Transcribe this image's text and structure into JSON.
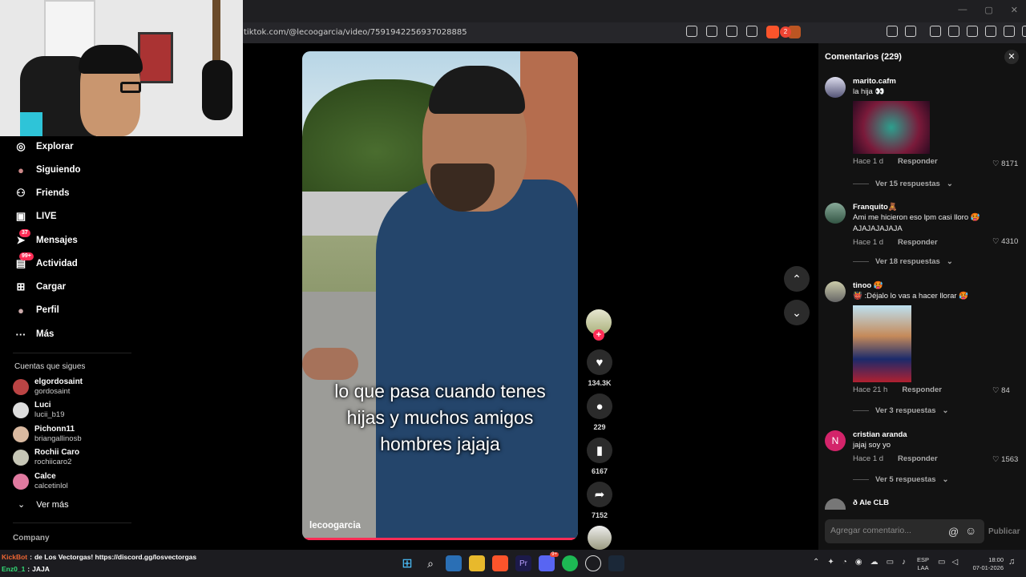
{
  "browser": {
    "url": "tiktok.com/@lecoogarcia/video/7591942256937028885",
    "brave_badge": "2",
    "window_controls": [
      "—",
      "▢",
      "✕"
    ]
  },
  "sidebar": {
    "items": [
      {
        "label": "Explorar",
        "icon": "compass-icon",
        "glyph": "◎"
      },
      {
        "label": "Siguiendo",
        "icon": "following-avatar-icon",
        "glyph": "●"
      },
      {
        "label": "Friends",
        "icon": "friends-icon",
        "glyph": "⚇"
      },
      {
        "label": "LIVE",
        "icon": "live-icon",
        "glyph": "▣"
      },
      {
        "label": "Mensajes",
        "icon": "messages-icon",
        "glyph": "➤",
        "badge": "37"
      },
      {
        "label": "Actividad",
        "icon": "activity-icon",
        "glyph": "▤",
        "badge": "99+"
      },
      {
        "label": "Cargar",
        "icon": "upload-icon",
        "glyph": "⊞"
      },
      {
        "label": "Perfil",
        "icon": "profile-icon",
        "glyph": "●"
      },
      {
        "label": "Más",
        "icon": "more-icon",
        "glyph": "···"
      }
    ],
    "following_title": "Cuentas que sigues",
    "following": [
      {
        "name": "elgordosaint",
        "user": "gordosaint"
      },
      {
        "name": "Luci",
        "user": "lucii_b19"
      },
      {
        "name": "Pichonn11",
        "user": "briangallinosb"
      },
      {
        "name": "Rochii Caro",
        "user": "rochiicaro2"
      },
      {
        "name": "Calce",
        "user": "calcetinlol"
      }
    ],
    "ver_mas": "Ver más",
    "company": "Company"
  },
  "video": {
    "caption_lines": [
      "lo que pasa cuando tenes",
      "hijas y muchos amigos",
      "hombres jajaja"
    ],
    "author": "lecoogarcia",
    "likes": "134.3K",
    "comments": "229",
    "saves": "6167",
    "shares": "7152"
  },
  "comments": {
    "title": "Comentarios (229)",
    "input_placeholder": "Agregar comentario...",
    "publish": "Publicar",
    "items": [
      {
        "user": "marito.cafm",
        "text": "la hija 👀",
        "time": "Hace 1 d",
        "reply": "Responder",
        "likes": "8171",
        "replies": "Ver 15 respuestas"
      },
      {
        "user": "Franquito🧸",
        "text": "Ami me hicieron eso lpm casi lloro 🥵 AJAJAJAJAJA",
        "time": "Hace 1 d",
        "reply": "Responder",
        "likes": "4310",
        "replies": "Ver 18 respuestas"
      },
      {
        "user": "tinoo 🥵",
        "text": "👹 :Déjalo lo vas a hacer llorar 🥵",
        "time": "Hace 21 h",
        "reply": "Responder",
        "likes": "84",
        "replies": "Ver 3 respuestas"
      },
      {
        "user": "cristian aranda",
        "text": "jajaj soy yo",
        "time": "Hace 1 d",
        "reply": "Responder",
        "likes": "1563",
        "replies": "Ver 5 respuestas",
        "avatar_letter": "N"
      },
      {
        "user": "ð Ale CLB",
        "text": ""
      }
    ]
  },
  "chat": {
    "line1_user": "KickBot",
    "line1_text": "de Los Vectorgas! https://discord.gg/losvectorgas",
    "line2_user": "Enz0_1",
    "line2_text": "JAJA"
  },
  "taskbar": {
    "lang1": "ESP",
    "lang2": "LAA",
    "time": "18:00",
    "date": "07-01-2026",
    "discord_badge": "9+"
  },
  "colors": {
    "accent": "#fe2c55",
    "background": "#000000",
    "panel": "#121212"
  }
}
